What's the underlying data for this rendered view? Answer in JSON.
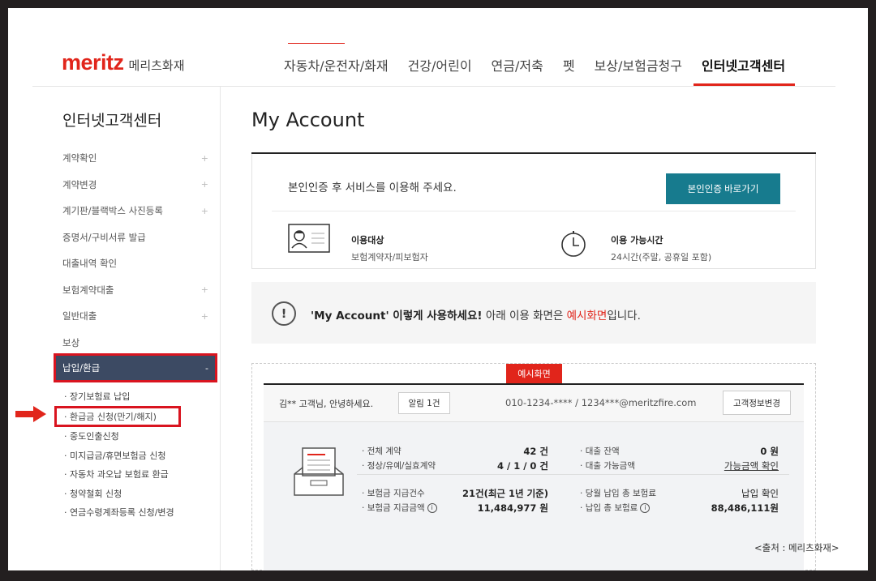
{
  "header": {
    "logo_main": "meritz",
    "logo_sub": "메리츠화재",
    "nav": [
      "자동차/운전자/화재",
      "건강/어린이",
      "연금/저축",
      "펫",
      "보상/보험금청구",
      "인터넷고객센터"
    ]
  },
  "sidebar": {
    "title": "인터넷고객센터",
    "items": [
      {
        "label": "계약확인",
        "plus": "+"
      },
      {
        "label": "계약변경",
        "plus": "+"
      },
      {
        "label": "계기판/블랙박스 사진등록",
        "plus": "+"
      },
      {
        "label": "증명서/구비서류 발급",
        "plus": ""
      },
      {
        "label": "대출내역 확인",
        "plus": ""
      },
      {
        "label": "보험계약대출",
        "plus": "+"
      },
      {
        "label": "일반대출",
        "plus": "+"
      },
      {
        "label": "보상",
        "plus": ""
      }
    ],
    "active_item": {
      "label": "납입/환급",
      "mark": "-"
    },
    "sub_items": [
      "· 장기보험료 납입",
      "· 환급금 신청(만기/해지)",
      "· 중도인출신청",
      "· 미지급금/휴면보험금 신청",
      "· 자동차 과오납 보험료 환급",
      "· 청약철회 신청",
      "· 연금수령계좌등록 신청/변경"
    ]
  },
  "main": {
    "title": "My Account",
    "auth_message": "본인인증 후 서비스를 이용해 주세요.",
    "auth_button": "본인인증 바로가기",
    "target_label": "이용대상",
    "target_value": "보험계약자/피보험자",
    "hours_label": "이용 가능시간",
    "hours_value": "24시간(주말, 공휴일 포함)",
    "notice_icon": "!",
    "notice_part1": "'My Account' 이렇게 사용하세요!",
    "notice_part2": " 아래 이용 화면은 ",
    "notice_red": "예시화면",
    "notice_part3": "입니다."
  },
  "example": {
    "badge": "예시화면",
    "customer": "김** 고객님, 안녕하세요.",
    "alarm": "알림 1건",
    "contact": "010-1234-**** / 1234***@meritzfire.com",
    "info_button": "고객정보변경",
    "stats": {
      "total_label": "전체 계약",
      "total_value": "42 건",
      "status_label": "정상/유예/실효계약",
      "status_value": "4 / 1 / 0 건",
      "loan_bal_label": "대출 잔액",
      "loan_bal_value": "0 원",
      "loan_avail_label": "대출 가능금액",
      "loan_avail_value": "가능금액 확인",
      "claims_count_label": "보험금 지급건수",
      "claims_count_value": "21건(최근 1년 기준)",
      "claims_amount_label": "보험금 지급금액",
      "claims_amount_value": "11,484,977 원",
      "month_pay_label": "당월 납입 총 보험료",
      "month_pay_value": "납입 확인",
      "total_pay_label": "납입 총 보험료",
      "total_pay_value": "88,486,111원",
      "info_mark": "i"
    }
  },
  "source": "<출처 : 메리츠화재>",
  "colors": {
    "brand": "#e1251b",
    "button": "#177b8e",
    "sidebar_active": "#3c4a63",
    "highlight": "#d9141f"
  }
}
